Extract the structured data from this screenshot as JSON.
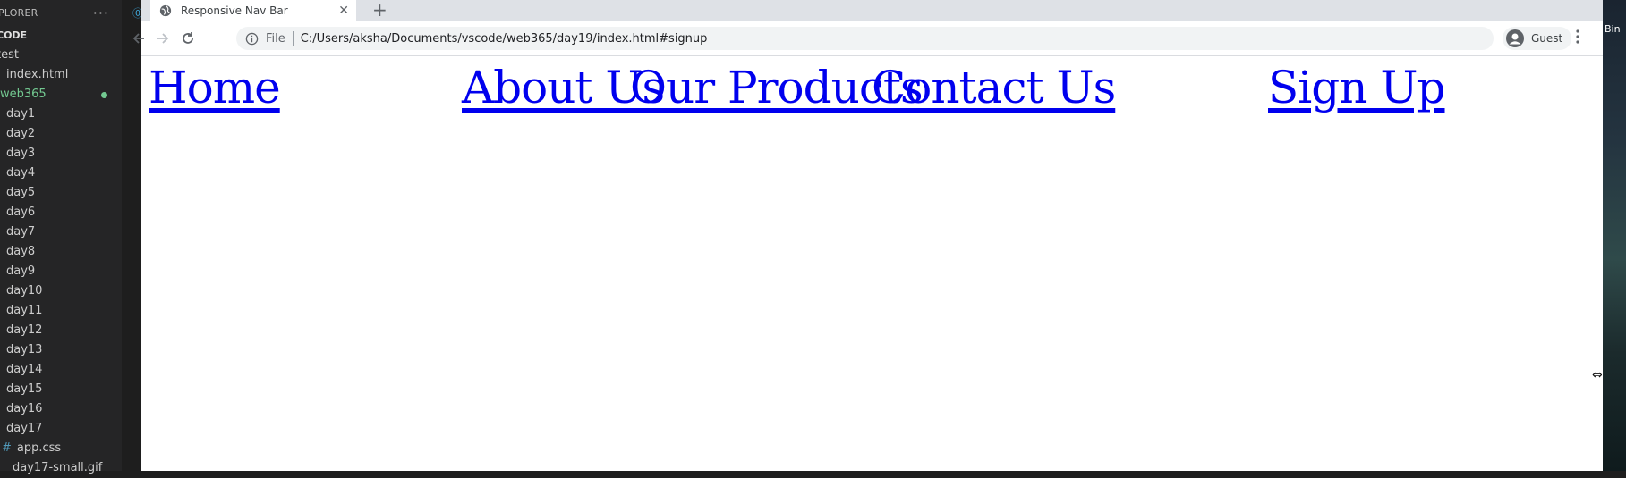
{
  "explorer": {
    "header": "PLORER",
    "more_label": "···",
    "section": "CODE",
    "items": [
      {
        "label": "test"
      },
      {
        "label": "index.html"
      },
      {
        "label": "web365"
      },
      {
        "label": "day1"
      },
      {
        "label": "day2"
      },
      {
        "label": "day3"
      },
      {
        "label": "day4"
      },
      {
        "label": "day5"
      },
      {
        "label": "day6"
      },
      {
        "label": "day7"
      },
      {
        "label": "day8"
      },
      {
        "label": "day9"
      },
      {
        "label": "day10"
      },
      {
        "label": "day11"
      },
      {
        "label": "day12"
      },
      {
        "label": "day13"
      },
      {
        "label": "day14"
      },
      {
        "label": "day15"
      },
      {
        "label": "day16"
      },
      {
        "label": "day17"
      },
      {
        "label": "app.css"
      },
      {
        "label": "day17-small.gif"
      }
    ],
    "active_color": "#73c991"
  },
  "browser": {
    "tab": {
      "title": "Responsive Nav Bar",
      "icon": "globe-icon"
    },
    "new_tab_label": "+",
    "address": {
      "scheme_label": "File",
      "url": "C:/Users/aksha/Documents/vscode/web365/day19/index.html#signup"
    },
    "profile_name": "Guest"
  },
  "nav": {
    "home": "Home",
    "about": "About Us",
    "products": "Our Products",
    "contact": "Contact Us",
    "signup": "Sign Up",
    "link_color": "#0000ee"
  },
  "desktop": {
    "bin_label": "Bin"
  }
}
